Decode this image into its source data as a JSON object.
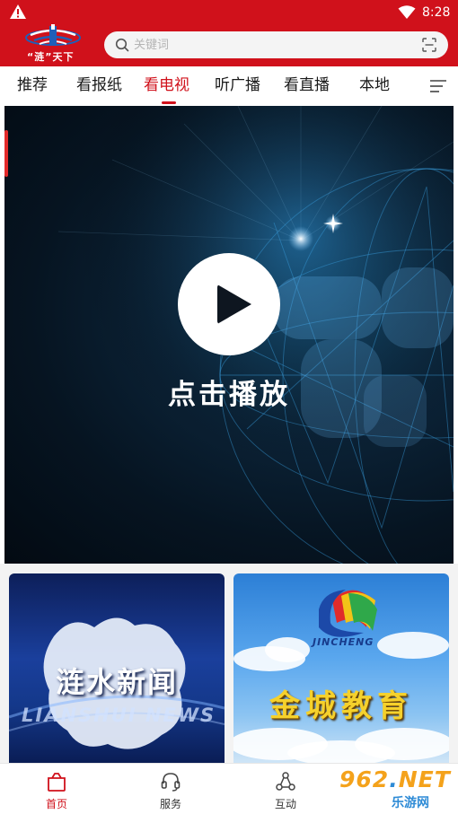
{
  "status_bar": {
    "time": "8:28",
    "warning_icon": "warning-icon",
    "wifi_icon": "wifi-icon"
  },
  "header": {
    "logo_text": "“涟”天下",
    "search": {
      "placeholder": "关键词",
      "value": ""
    }
  },
  "tabs": [
    {
      "label": "推荐",
      "active": false
    },
    {
      "label": "看报纸",
      "active": false
    },
    {
      "label": "看电视",
      "active": true
    },
    {
      "label": "听广播",
      "active": false
    },
    {
      "label": "看直播",
      "active": false
    },
    {
      "label": "本地",
      "active": false
    }
  ],
  "video": {
    "play_label": "点击播放"
  },
  "cards": [
    {
      "title": "涟水新闻",
      "subtitle": "LIANSHUI NEWS"
    },
    {
      "brand": "JINCHENG",
      "title": "金城教育"
    }
  ],
  "bottom_nav": [
    {
      "label": "首页",
      "icon": "home-icon",
      "active": true
    },
    {
      "label": "服务",
      "icon": "headset-icon",
      "active": false
    },
    {
      "label": "互动",
      "icon": "interact-icon",
      "active": false
    }
  ],
  "watermark": {
    "main": "962",
    "dot": ".",
    "tld": "NET",
    "sub": "乐游网"
  },
  "colors": {
    "brand_red": "#d0111b",
    "inactive_text": "#1a1a1a"
  }
}
